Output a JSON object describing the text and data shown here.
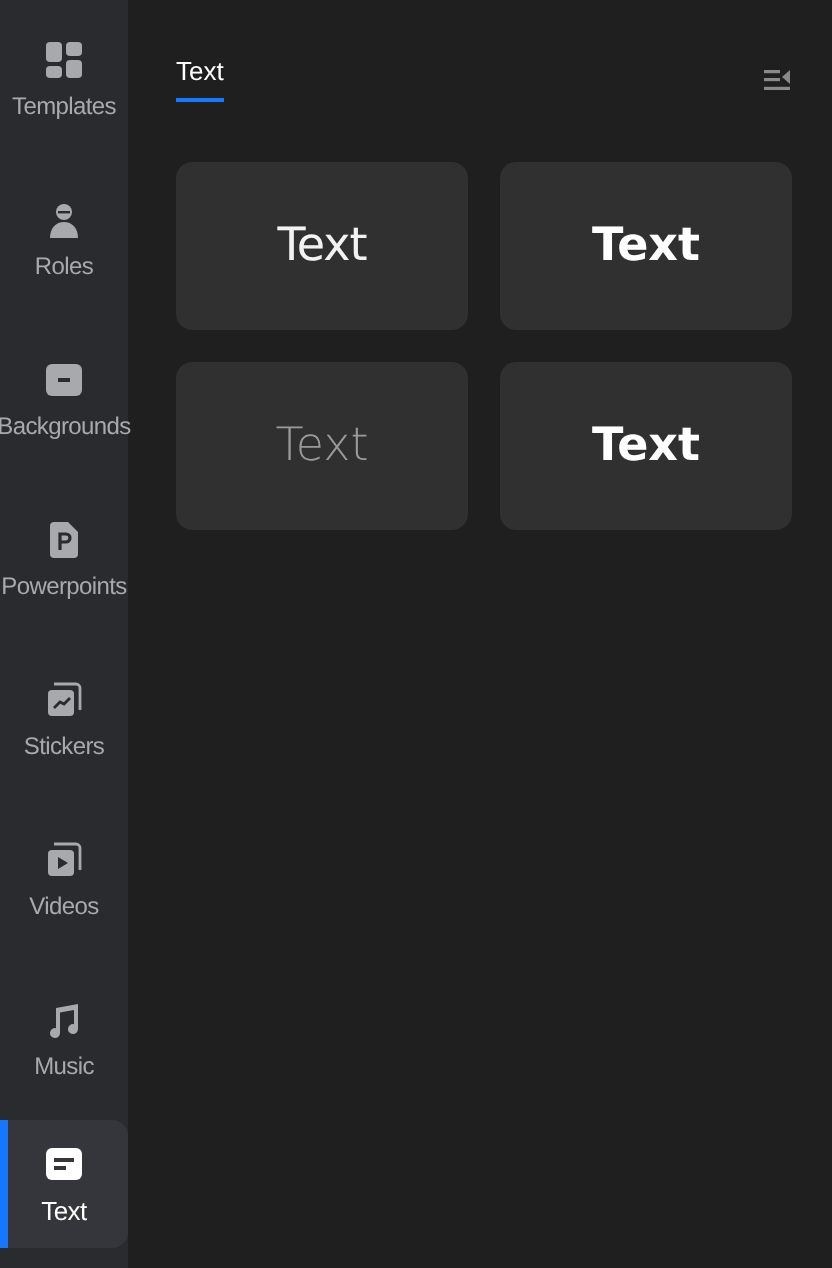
{
  "sidebar": {
    "items": [
      {
        "label": "Templates",
        "selected": false
      },
      {
        "label": "Roles",
        "selected": false
      },
      {
        "label": "Backgrounds",
        "selected": false
      },
      {
        "label": "Powerpoints",
        "selected": false
      },
      {
        "label": "Stickers",
        "selected": false
      },
      {
        "label": "Videos",
        "selected": false
      },
      {
        "label": "Music",
        "selected": false
      },
      {
        "label": "Text",
        "selected": true
      }
    ]
  },
  "tabs": [
    {
      "label": "Text",
      "selected": true
    }
  ],
  "text_styles": [
    {
      "label": "Text"
    },
    {
      "label": "Text"
    },
    {
      "label": "Text"
    },
    {
      "label": "Text"
    }
  ]
}
